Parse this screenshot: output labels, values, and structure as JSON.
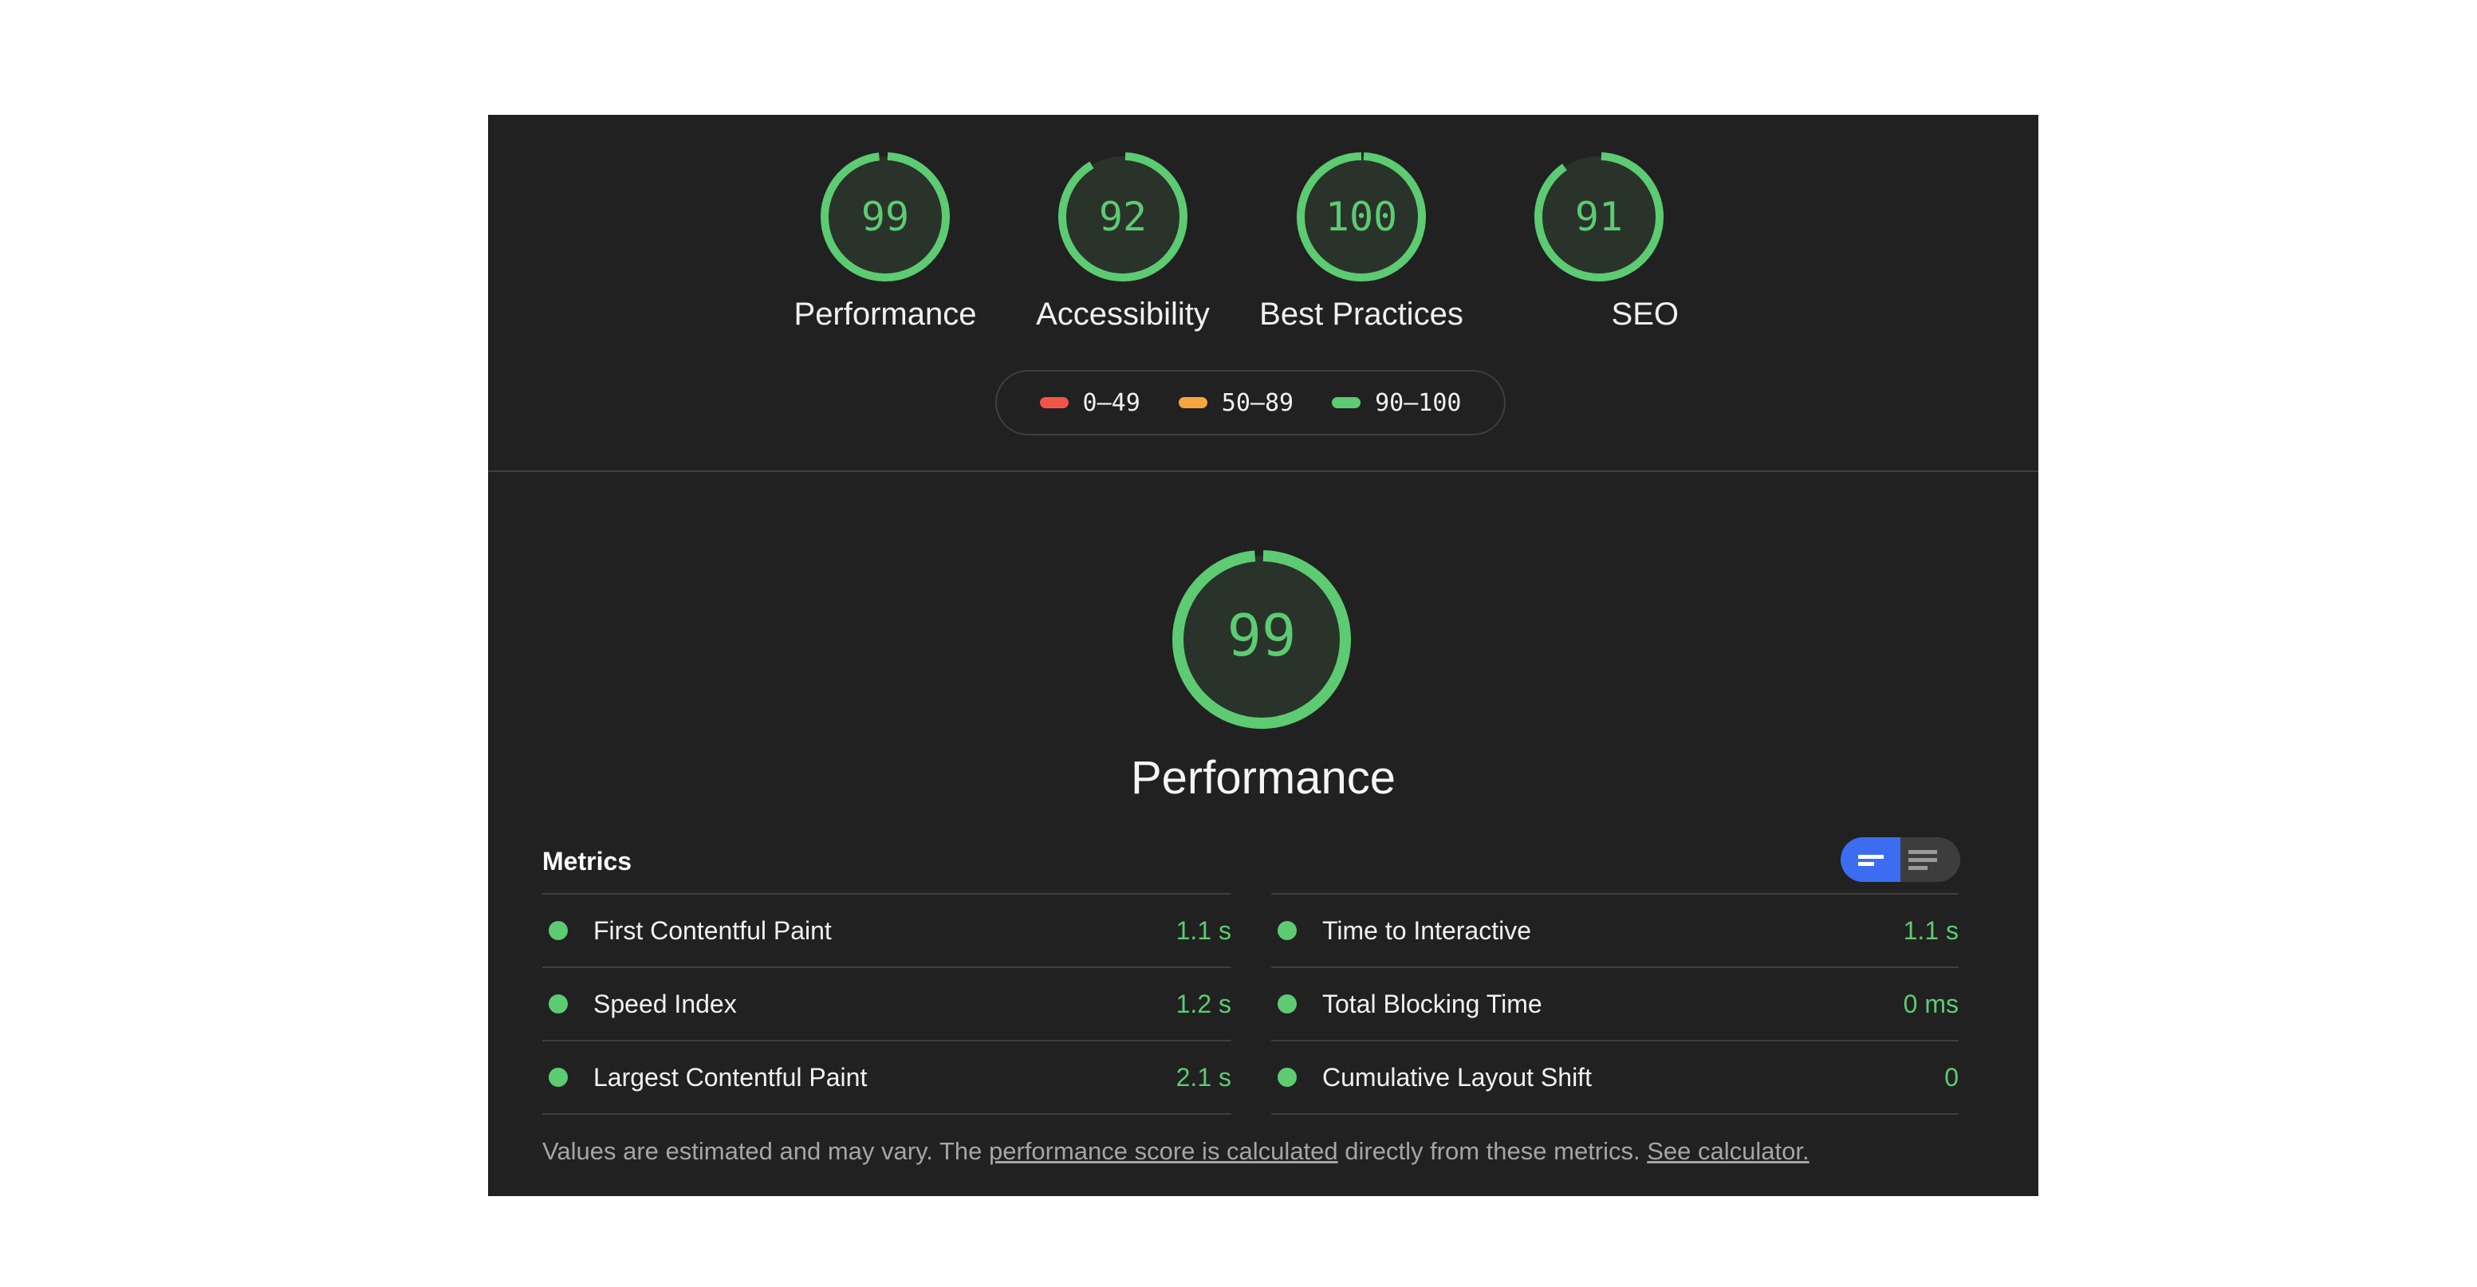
{
  "colors": {
    "pass": "#5ccb72",
    "average": "#f4a73c",
    "fail": "#f0554b",
    "gauge_fill": "#2a3329",
    "toggle_active": "#3c6df0"
  },
  "categories": [
    {
      "label": "Performance",
      "score": 99
    },
    {
      "label": "Accessibility",
      "score": 92
    },
    {
      "label": "Best Practices",
      "score": 100
    },
    {
      "label": "SEO",
      "score": 91
    }
  ],
  "legend": [
    {
      "range": "0–49",
      "status": "fail"
    },
    {
      "range": "50–89",
      "status": "average"
    },
    {
      "range": "90–100",
      "status": "pass"
    }
  ],
  "main": {
    "title": "Performance",
    "score": 99
  },
  "metrics": {
    "title": "Metrics",
    "view_toggle": {
      "active": "summary",
      "options": [
        "summary-view",
        "expanded-view"
      ]
    },
    "left": [
      {
        "name": "First Contentful Paint",
        "value": "1.1 s",
        "status": "pass"
      },
      {
        "name": "Speed Index",
        "value": "1.2 s",
        "status": "pass"
      },
      {
        "name": "Largest Contentful Paint",
        "value": "2.1 s",
        "status": "pass"
      }
    ],
    "right": [
      {
        "name": "Time to Interactive",
        "value": "1.1 s",
        "status": "pass"
      },
      {
        "name": "Total Blocking Time",
        "value": "0 ms",
        "status": "pass"
      },
      {
        "name": "Cumulative Layout Shift",
        "value": "0",
        "status": "pass"
      }
    ]
  },
  "footer": {
    "text_1": "Values are estimated and may vary. The ",
    "link_1": "performance score is calculated",
    "text_2": " directly from these metrics. ",
    "link_2": "See calculator."
  }
}
